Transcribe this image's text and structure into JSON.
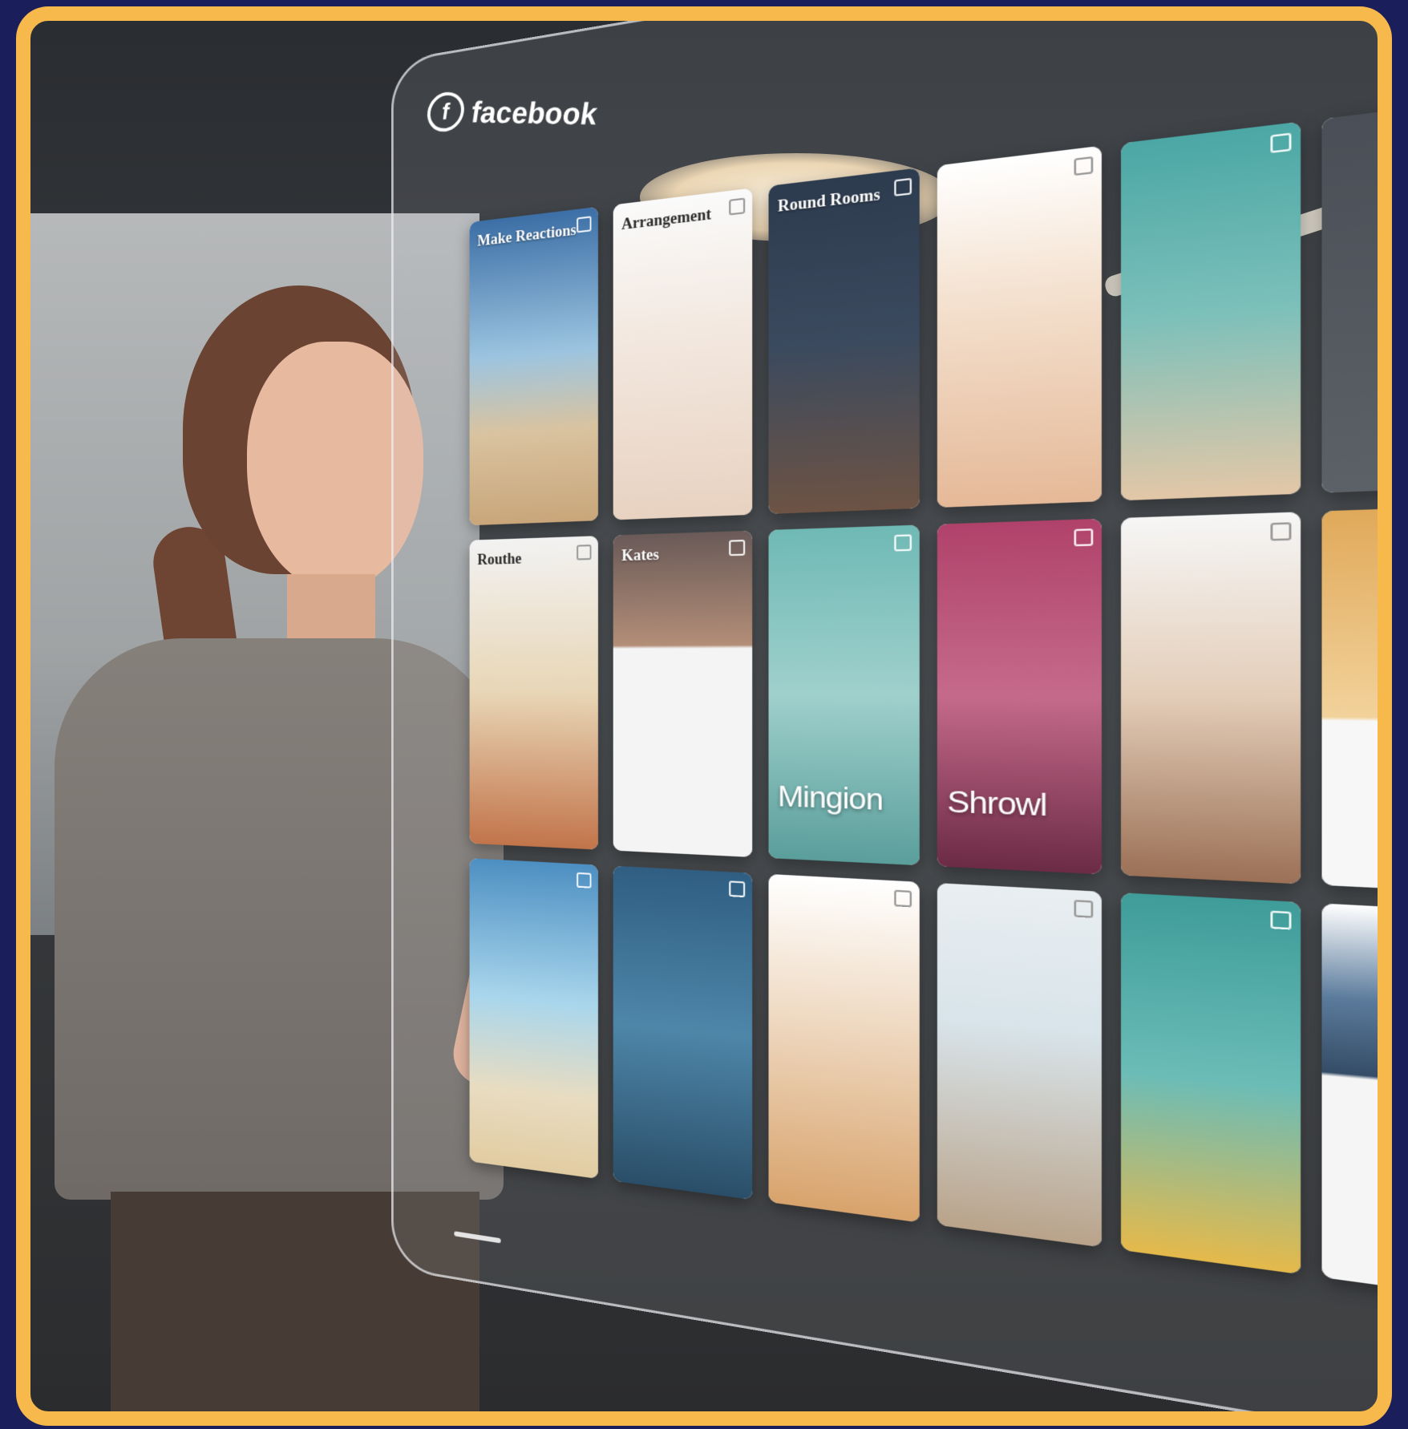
{
  "brand": {
    "name": "facebook",
    "icon": "facebook-logo-icon"
  },
  "header": {
    "right_text": ""
  },
  "cards": [
    {
      "title": "Make Reactions",
      "style": "dark",
      "bg": "linear-gradient(180deg,#3c6fa6 0%,#9cc4e0 45%,#d9c3a0 70%,#c9a67a 100%)"
    },
    {
      "title": "Arrangement",
      "style": "light",
      "bg": "linear-gradient(180deg,#fafafa 0%,#f3e9e1 40%,#e8d2c1 100%)"
    },
    {
      "title": "Round Rooms",
      "style": "dark",
      "bg": "linear-gradient(180deg,#2d3b4f 0%,#3b4a5e 50%,#6d5344 100%)"
    },
    {
      "title": "",
      "style": "light",
      "bg": "linear-gradient(180deg,#ffffff 0%,#f4e1cf 40%,#e5b998 100%)"
    },
    {
      "title": "",
      "style": "dark",
      "bg": "linear-gradient(180deg,#4ba7a5 0%,#7dc0ba 50%,#e3c7a7 100%)"
    },
    {
      "title": "",
      "style": "dark",
      "bg": "linear-gradient(180deg,#4a4f57 0%,#5c6168 100%)"
    },
    {
      "title": "Routhe",
      "style": "light",
      "bg": "linear-gradient(180deg,#f2f2f2 0%,#e8d6b6 50%,#c2744a 100%)"
    },
    {
      "title": "Kates",
      "style": "dark",
      "bg": "linear-gradient(180deg,#6a5a58 0%,#b38e78 35%,#f4f4f4 36%,#f4f4f4 100%)"
    },
    {
      "title": "",
      "style": "dark",
      "big": "Mingion",
      "bg": "linear-gradient(180deg,#6fb9b5 0%,#9fd0cc 50%,#5a9e9b 100%)"
    },
    {
      "title": "",
      "style": "dark",
      "big": "Shrowl",
      "bg": "linear-gradient(180deg,#b0426a 0%,#c56a8a 50%,#6b2b45 100%)"
    },
    {
      "title": "",
      "style": "light",
      "bg": "linear-gradient(180deg,#f6f6f6 0%,#e3cdb8 50%,#9b7056 100%)"
    },
    {
      "title": "",
      "style": "dark",
      "bg": "linear-gradient(180deg,#e0a95a 0%,#f2d29b 55%,#f7f7f7 56%,#f7f7f7 100%)"
    },
    {
      "title": "",
      "style": "dark",
      "bg": "linear-gradient(180deg,#4d8fc2 0%,#a9d6ec 45%,#e8dcc1 75%,#e2cca2 100%)"
    },
    {
      "title": "",
      "style": "dark",
      "bg": "linear-gradient(180deg,#2f5e82 0%,#4e86a9 50%,#2a4e68 100%)"
    },
    {
      "title": "",
      "style": "light",
      "bg": "linear-gradient(180deg,#ffffff 0%,#f0dcc6 40%,#d8a36c 100%)"
    },
    {
      "title": "",
      "style": "light",
      "bg": "linear-gradient(180deg,#e9eef1 0%,#d8e4ea 40%,#b9a38a 100%)"
    },
    {
      "title": "",
      "style": "dark",
      "bg": "linear-gradient(180deg,#3e9c99 0%,#6bbcb7 50%,#e5b94b 100%)"
    },
    {
      "title": "",
      "style": "light",
      "bg": "linear-gradient(180deg,#ffffff 0%,#5b7b9c 25%,#354c66 45%,#f5f5f5 46%,#f5f5f5 100%)"
    }
  ]
}
